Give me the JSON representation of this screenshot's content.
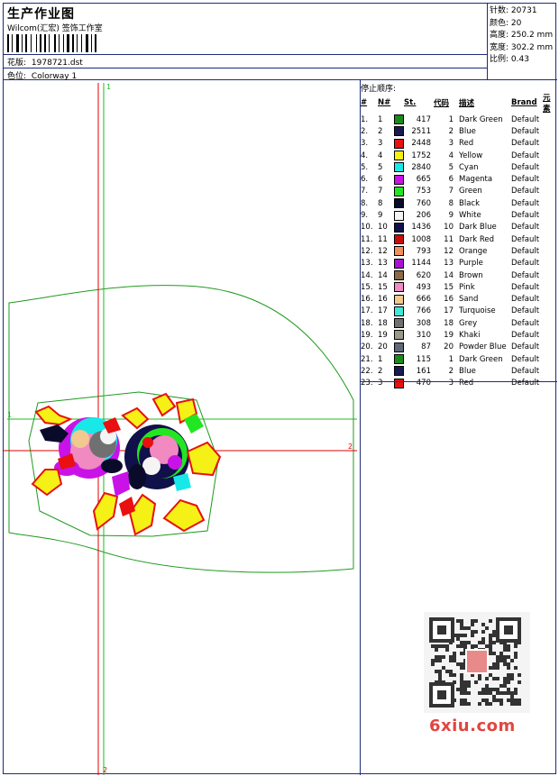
{
  "header": {
    "title": "生产作业图",
    "company": "Wilcom(汇宏) 签饰工作室",
    "design_label": "花版:",
    "design_value": "1978721.dst",
    "colorway_label": "色位:",
    "colorway_value": "Colorway 1"
  },
  "stats": {
    "stitches_label": "针数:",
    "stitches_value": "20731",
    "colors_label": "颜色:",
    "colors_value": "20",
    "height_label": "高度:",
    "height_value": "250.2 mm",
    "width_label": "宽度:",
    "width_value": "302.2 mm",
    "scale_label": "比例:",
    "scale_value": "0.43"
  },
  "axes": {
    "top_marker": "1",
    "left_marker": "1",
    "right_marker": "2",
    "bottom_marker": "2"
  },
  "stop_sequence": {
    "title": "停止顺序:",
    "columns": [
      "#",
      "N#",
      "St.",
      "代码",
      "描述",
      "Brand",
      "元素"
    ],
    "rows": [
      {
        "idx": "1.",
        "n": "1",
        "color": "#1a8a1a",
        "st": "417",
        "code": "1",
        "desc": "Dark Green",
        "brand": "Default"
      },
      {
        "idx": "2.",
        "n": "2",
        "color": "#1a1a50",
        "st": "2511",
        "code": "2",
        "desc": "Blue",
        "brand": "Default"
      },
      {
        "idx": "3.",
        "n": "3",
        "color": "#e81010",
        "st": "2448",
        "code": "3",
        "desc": "Red",
        "brand": "Default"
      },
      {
        "idx": "4.",
        "n": "4",
        "color": "#f5f016",
        "st": "1752",
        "code": "4",
        "desc": "Yellow",
        "brand": "Default"
      },
      {
        "idx": "5.",
        "n": "5",
        "color": "#19e8e8",
        "st": "2840",
        "code": "5",
        "desc": "Cyan",
        "brand": "Default"
      },
      {
        "idx": "6.",
        "n": "6",
        "color": "#c912e8",
        "st": "665",
        "code": "6",
        "desc": "Magenta",
        "brand": "Default"
      },
      {
        "idx": "7.",
        "n": "7",
        "color": "#22e622",
        "st": "753",
        "code": "7",
        "desc": "Green",
        "brand": "Default"
      },
      {
        "idx": "8.",
        "n": "8",
        "color": "#0a0a2a",
        "st": "760",
        "code": "8",
        "desc": "Black",
        "brand": "Default"
      },
      {
        "idx": "9.",
        "n": "9",
        "color": "#f4f4f4",
        "st": "206",
        "code": "9",
        "desc": "White",
        "brand": "Default"
      },
      {
        "idx": "10.",
        "n": "10",
        "color": "#10104a",
        "st": "1436",
        "code": "10",
        "desc": "Dark Blue",
        "brand": "Default"
      },
      {
        "idx": "11.",
        "n": "11",
        "color": "#c80c0c",
        "st": "1008",
        "code": "11",
        "desc": "Dark Red",
        "brand": "Default"
      },
      {
        "idx": "12.",
        "n": "12",
        "color": "#f0905a",
        "st": "793",
        "code": "12",
        "desc": "Orange",
        "brand": "Default"
      },
      {
        "idx": "13.",
        "n": "13",
        "color": "#a812d6",
        "st": "1144",
        "code": "13",
        "desc": "Purple",
        "brand": "Default"
      },
      {
        "idx": "14.",
        "n": "14",
        "color": "#8a6a48",
        "st": "620",
        "code": "14",
        "desc": "Brown",
        "brand": "Default"
      },
      {
        "idx": "15.",
        "n": "15",
        "color": "#f08ac0",
        "st": "493",
        "code": "15",
        "desc": "Pink",
        "brand": "Default"
      },
      {
        "idx": "16.",
        "n": "16",
        "color": "#f0c890",
        "st": "666",
        "code": "16",
        "desc": "Sand",
        "brand": "Default"
      },
      {
        "idx": "17.",
        "n": "17",
        "color": "#40e8d8",
        "st": "766",
        "code": "17",
        "desc": "Turquoise",
        "brand": "Default"
      },
      {
        "idx": "18.",
        "n": "18",
        "color": "#707070",
        "st": "308",
        "code": "18",
        "desc": "Grey",
        "brand": "Default"
      },
      {
        "idx": "19.",
        "n": "19",
        "color": "#9a9a8a",
        "st": "310",
        "code": "19",
        "desc": "Khaki",
        "brand": "Default"
      },
      {
        "idx": "20.",
        "n": "20",
        "color": "#606878",
        "st": "87",
        "code": "20",
        "desc": "Powder Blue",
        "brand": "Default"
      },
      {
        "idx": "21.",
        "n": "1",
        "color": "#1a8a1a",
        "st": "115",
        "code": "1",
        "desc": "Dark Green",
        "brand": "Default"
      },
      {
        "idx": "22.",
        "n": "2",
        "color": "#1a1a50",
        "st": "161",
        "code": "2",
        "desc": "Blue",
        "brand": "Default"
      },
      {
        "idx": "23.",
        "n": "3",
        "color": "#e81010",
        "st": "470",
        "code": "3",
        "desc": "Red",
        "brand": "Default"
      }
    ]
  },
  "watermark": {
    "url": "6xiu.com"
  },
  "colors": {
    "frame_border": "#1e2b7a",
    "axis_red": "#e00000",
    "axis_green": "#22b822",
    "outline_green": "#1f9a1f"
  }
}
